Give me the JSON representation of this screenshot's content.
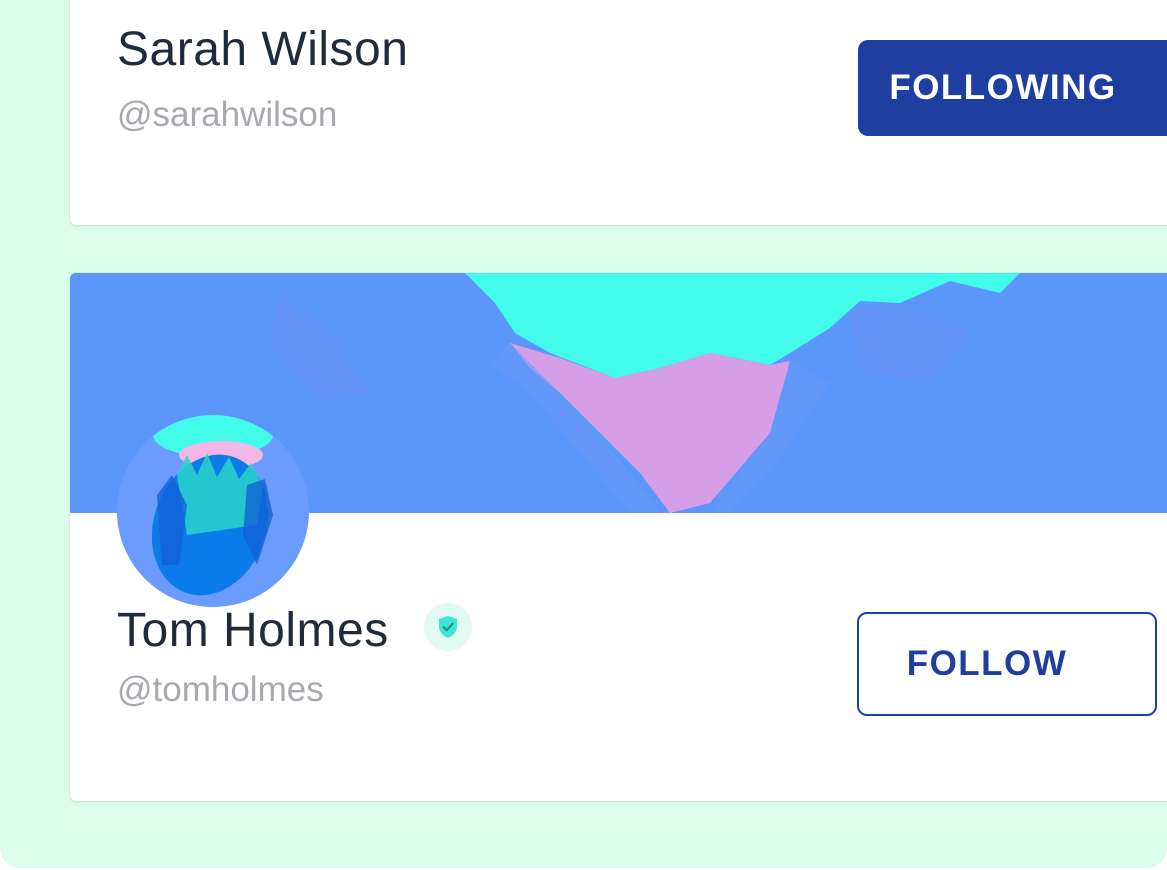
{
  "users": [
    {
      "name": "Sarah Wilson",
      "handle": "@sarahwilson",
      "button_label": "FOLLOWING"
    },
    {
      "name": "Tom Holmes",
      "handle": "@tomholmes",
      "button_label": "FOLLOW"
    }
  ],
  "colors": {
    "panel_background": "#dcfcec",
    "primary": "#1f3fa0",
    "cover_blue": "#5b96fb",
    "cover_sky": "#43fbe9",
    "cover_pink": "#d69ee6",
    "verified_icon": "#3ee5d3"
  },
  "icons": {
    "verified": "shield-check-icon"
  }
}
